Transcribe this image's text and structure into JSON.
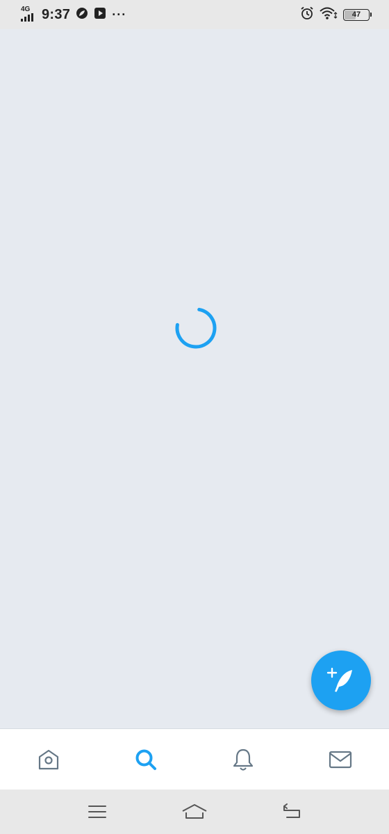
{
  "status_bar": {
    "network_type": "4G",
    "time": "9:37",
    "battery_level": "47",
    "battery_fraction": 0.47,
    "icons": [
      "signal-icon",
      "app-notification-icon",
      "video-notification-icon",
      "more-notifications-icon",
      "alarm-icon",
      "wifi-icon",
      "battery-icon"
    ]
  },
  "content": {
    "state": "loading",
    "spinner_color": "#1da1f2"
  },
  "fab": {
    "icon": "compose-tweet-icon",
    "color": "#1da1f2"
  },
  "tab_bar": {
    "active": "search",
    "active_color": "#1da1f2",
    "inactive_color": "#657786",
    "tabs": [
      {
        "id": "home",
        "icon": "home-icon"
      },
      {
        "id": "search",
        "icon": "search-icon"
      },
      {
        "id": "notifications",
        "icon": "bell-icon"
      },
      {
        "id": "messages",
        "icon": "mail-icon"
      }
    ]
  },
  "nav_bar": {
    "buttons": [
      "menu-icon",
      "home-button-icon",
      "back-icon"
    ]
  }
}
